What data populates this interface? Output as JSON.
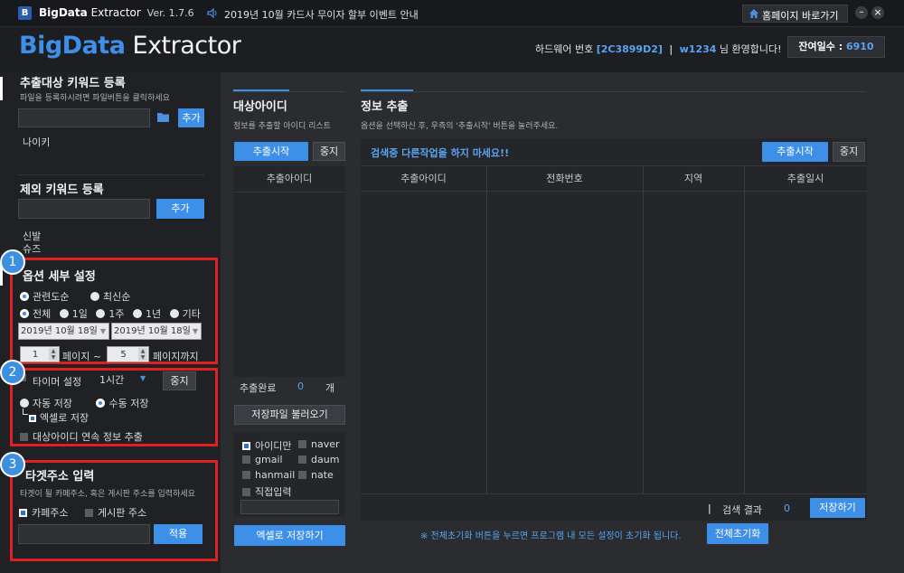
{
  "titlebar": {
    "app_name": "BigData",
    "app_name2": "Extractor",
    "version": "Ver. 1.7.6",
    "notice": "2019년 10월 카드사 무이자 할부 이벤트 안내",
    "homepage_btn": "홈페이지 바로가기",
    "minimize": "–",
    "close": "×"
  },
  "header": {
    "logo_a": "BigData",
    "logo_b": " Extractor",
    "hw_label": "하드웨어 번호",
    "hw_value": "[2C3899D2]",
    "sep": "|",
    "user": "w1234",
    "welcome": "님 환영합니다!",
    "days_label": "잔여일수 : ",
    "days_value": "6910"
  },
  "left": {
    "kw_title": "추출대상 키워드 등록",
    "kw_sub": "파일을 등록하시려면 파일버튼을 클릭하세요",
    "kw_add": "추가",
    "kw_item": "나이키",
    "ex_title": "제외 키워드 등록",
    "ex_add": "추가",
    "ex_items": [
      "신발",
      "슈즈"
    ],
    "opt_title": "옵션 세부 설정",
    "sort1": "관련도순",
    "sort2": "최신순",
    "per_all": "전체",
    "per_1d": "1일",
    "per_1w": "1주",
    "per_1y": "1년",
    "per_etc": "기타",
    "date_from": "2019년 10월 18일",
    "date_to": "2019년 10월 18일",
    "page_from": "1",
    "page_mid": "페이지 ~",
    "page_to": "5",
    "page_end": "페이지까지",
    "timer_label": "타이머 설정",
    "timer_value": "1시간",
    "timer_stop": "중지",
    "auto_save": "자동 저장",
    "manual_save": "수동 저장",
    "excel_save": "엑셀로 저장",
    "continuous": "대상아이디 연속 정보 추출",
    "target_title": "타겟주소 입력",
    "target_sub": "타겟이 될 카페주소, 혹은 게시판 주소를 입력하세요",
    "cafe": "카페주소",
    "board": "게시판 주소",
    "apply": "적용",
    "badges": [
      "1",
      "2",
      "3"
    ]
  },
  "ids": {
    "title": "대상아이디",
    "sub": "정보를 추출할 아이디 리스트",
    "start": "추출시작",
    "stop": "중지",
    "col": "추출아이디",
    "done_label": "추출완료",
    "done_count": "0",
    "done_unit": "개",
    "load": "저장파일 불러오기",
    "only_id": "아이디만",
    "naver": "naver",
    "gmail": "gmail",
    "daum": "daum",
    "hanmail": "hanmail",
    "nate": "nate",
    "direct": "직접입력",
    "excel": "엑셀로 저장하기"
  },
  "info": {
    "title": "정보 추출",
    "sub": "옵션을 선택하신 후, 우측의 '추출시작' 버튼을 눌러주세요.",
    "warn": "검색중 다른작업을 하지 마세요!!",
    "start": "추출시작",
    "stop": "중지",
    "cols": [
      "추출아이디",
      "전화번호",
      "지역",
      "추출일시"
    ],
    "result_sep": "|",
    "result_label": "검색 결과",
    "result_count": "0",
    "save": "저장하기",
    "reset_note": "※ 전체초기화 버튼을 누르면 프로그램 내 모든 설정이 초기화 됩니다.",
    "reset": "전체초기화"
  }
}
